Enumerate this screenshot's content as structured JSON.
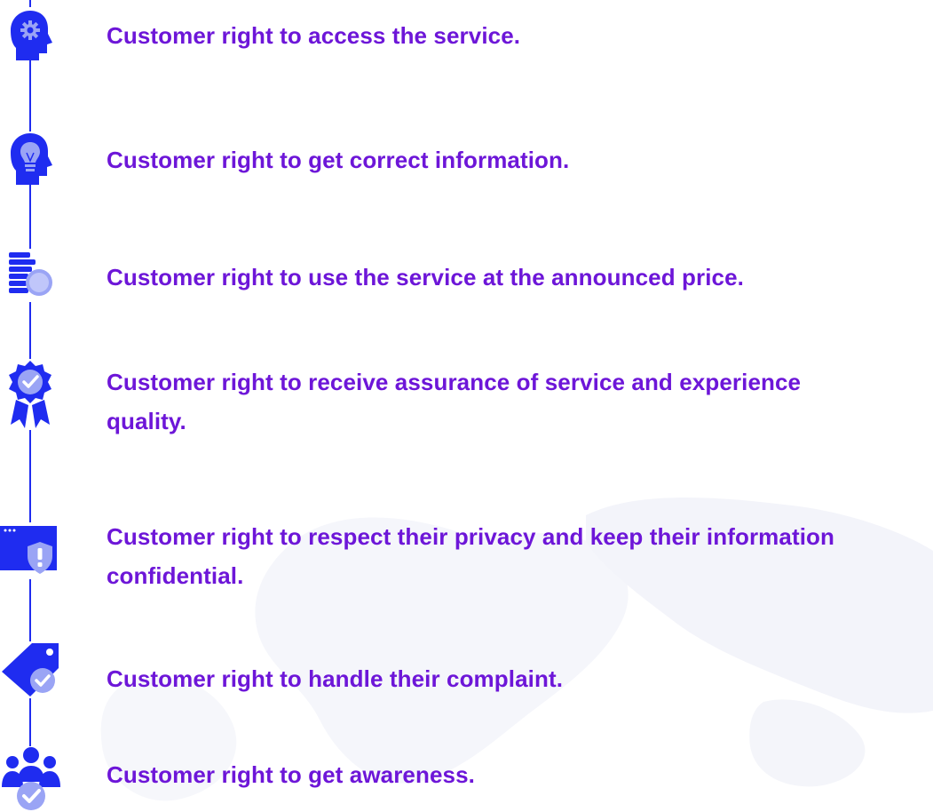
{
  "colors": {
    "text": "#6d16d8",
    "icon": "#1f2cf0",
    "icon_light": "#9aa4f5",
    "line": "#1f2cf0",
    "map": "#f4f5fb"
  },
  "rights": [
    {
      "icon": "head-gear-icon",
      "text": "Customer right to access the service."
    },
    {
      "icon": "head-lightbulb-icon",
      "text": "Customer right to get correct information."
    },
    {
      "icon": "coins-clock-icon",
      "text": "Customer right to use the service at the announced price."
    },
    {
      "icon": "award-ribbon-check-icon",
      "text": "Customer right to receive assurance of service and experience quality."
    },
    {
      "icon": "browser-shield-icon",
      "text": "Customer right to respect their privacy and keep their information confidential."
    },
    {
      "icon": "tag-check-icon",
      "text": "Customer right to handle their complaint."
    },
    {
      "icon": "group-check-icon",
      "text": "Customer right to get awareness."
    }
  ]
}
